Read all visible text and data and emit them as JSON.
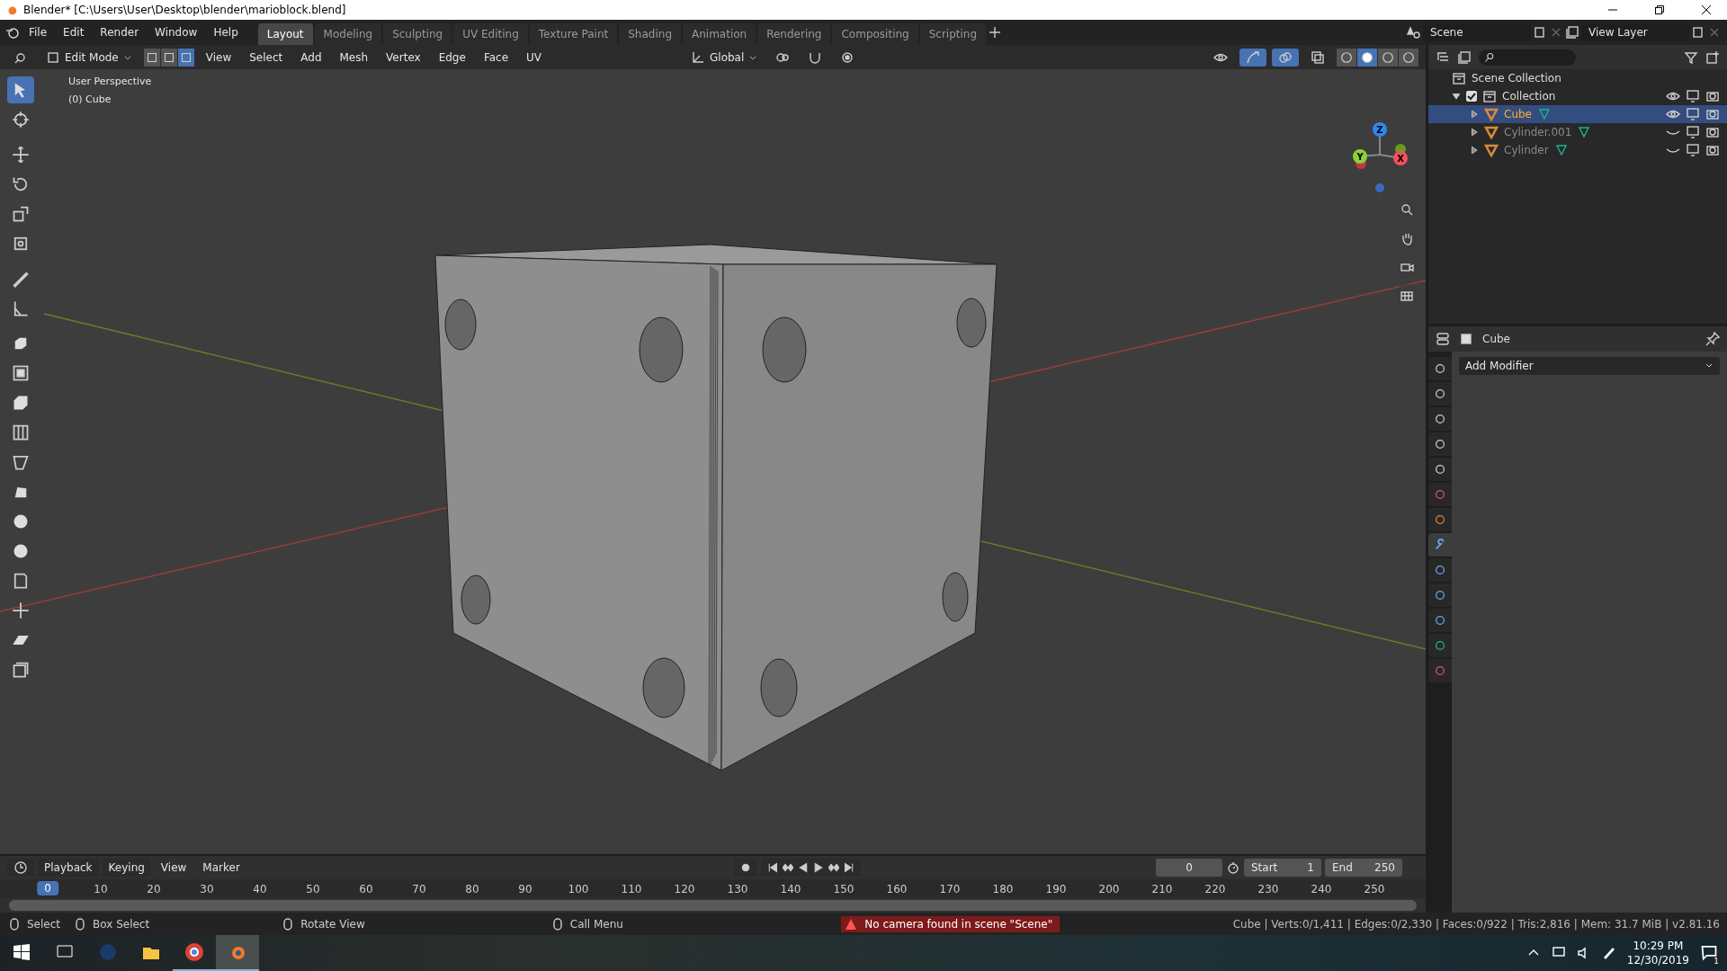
{
  "window": {
    "title": "Blender* [C:\\Users\\User\\Desktop\\blender\\marioblock.blend]"
  },
  "menu": [
    "File",
    "Edit",
    "Render",
    "Window",
    "Help"
  ],
  "workspaces": [
    {
      "label": "Layout",
      "selected": true
    },
    {
      "label": "Modeling",
      "selected": false
    },
    {
      "label": "Sculpting",
      "selected": false
    },
    {
      "label": "UV Editing",
      "selected": false
    },
    {
      "label": "Texture Paint",
      "selected": false
    },
    {
      "label": "Shading",
      "selected": false
    },
    {
      "label": "Animation",
      "selected": false
    },
    {
      "label": "Rendering",
      "selected": false
    },
    {
      "label": "Compositing",
      "selected": false
    },
    {
      "label": "Scripting",
      "selected": false
    }
  ],
  "scene": {
    "scene": "Scene",
    "view_layer": "View Layer"
  },
  "viewport_header": {
    "mode": "Edit Mode",
    "select_modes": [
      {
        "selected": false
      },
      {
        "selected": false
      },
      {
        "selected": true
      }
    ],
    "menus": [
      "View",
      "Select",
      "Add",
      "Mesh",
      "Vertex",
      "Edge",
      "Face",
      "UV"
    ],
    "orientation": "Global",
    "shading": [
      {
        "selected": false
      },
      {
        "selected": true
      },
      {
        "selected": false
      },
      {
        "selected": false
      }
    ]
  },
  "viewport": {
    "perspective": "User Perspective",
    "object": "(0) Cube",
    "gizmo": [
      "Z",
      "Y",
      "X"
    ],
    "tools": [
      {
        "selected": true
      },
      {
        "selected": false
      },
      {
        "selected": false
      },
      {
        "selected": false
      },
      {
        "selected": false
      },
      {
        "selected": false
      },
      {
        "selected": false
      },
      {
        "selected": false
      },
      {
        "selected": false
      },
      {
        "selected": false
      },
      {
        "selected": false
      },
      {
        "selected": false
      },
      {
        "selected": false
      },
      {
        "selected": false
      },
      {
        "selected": false
      },
      {
        "selected": false
      },
      {
        "selected": false
      },
      {
        "selected": false
      },
      {
        "selected": false
      },
      {
        "selected": false
      }
    ]
  },
  "outliner": {
    "root": "Scene Collection",
    "items": [
      {
        "label": "Collection",
        "checked": true,
        "expanded": true,
        "children": [
          {
            "label": "Cube",
            "selected": true
          },
          {
            "label": "Cylinder.001",
            "selected": false
          },
          {
            "label": "Cylinder",
            "selected": false
          }
        ]
      }
    ]
  },
  "properties": {
    "object": "Cube",
    "button": "Add Modifier",
    "tabs": [
      {
        "selected": false
      },
      {
        "selected": false
      },
      {
        "selected": false
      },
      {
        "selected": false
      },
      {
        "selected": false
      },
      {
        "selected": false
      },
      {
        "selected": false
      },
      {
        "selected": true
      },
      {
        "selected": false
      },
      {
        "selected": false
      },
      {
        "selected": false
      },
      {
        "selected": false
      },
      {
        "selected": false
      }
    ]
  },
  "timeline": {
    "menus": [
      "Playback",
      "Keying",
      "View",
      "Marker"
    ],
    "frame": "0",
    "start_label": "Start",
    "start": "1",
    "end_label": "End",
    "end": "250",
    "current": "0",
    "ticks": [
      "10",
      "20",
      "30",
      "40",
      "50",
      "60",
      "70",
      "80",
      "90",
      "100",
      "110",
      "120",
      "130",
      "140",
      "150",
      "160",
      "170",
      "180",
      "190",
      "200",
      "210",
      "220",
      "230",
      "240",
      "250"
    ]
  },
  "status": {
    "hints": [
      "Select",
      "Box Select",
      "Rotate View",
      "Call Menu"
    ],
    "warning": "No camera found in scene \"Scene\"",
    "stats": "Cube | Verts:0/1,411 | Edges:0/2,330 | Faces:0/922 | Tris:2,816 | Mem: 31.7 MiB | v2.81.16"
  },
  "taskbar": {
    "apps": [
      {
        "running": false,
        "active": false
      },
      {
        "running": false,
        "active": false
      },
      {
        "running": false,
        "active": false
      },
      {
        "running": true,
        "active": false
      },
      {
        "running": true,
        "active": true
      }
    ],
    "time": "10:29 PM",
    "date": "12/30/2019",
    "notifications": "1"
  }
}
